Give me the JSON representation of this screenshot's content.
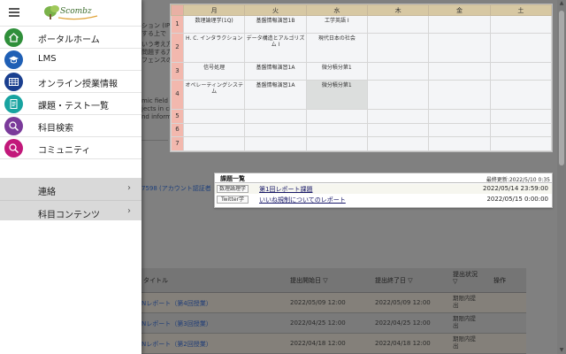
{
  "drawer": {
    "logo_text": "Scombz",
    "nav_items": [
      {
        "label": "ポータルホーム",
        "icon": "home-icon",
        "color": "#2f8f3a"
      },
      {
        "label": "LMS",
        "icon": "graduation-cap-icon",
        "color": "#1f5fb5"
      },
      {
        "label": "オンライン授業情報",
        "icon": "calendar-grid-icon",
        "color": "#1a3f8f"
      },
      {
        "label": "課題・テスト一覧",
        "icon": "clipboard-list-icon",
        "color": "#17a3a0"
      },
      {
        "label": "科目検索",
        "icon": "search-icon",
        "color": "#7a3a9a"
      },
      {
        "label": "コミュニティ",
        "icon": "search-people-icon",
        "color": "#c2187a"
      }
    ],
    "sub_items": [
      {
        "label": "連絡",
        "chevron": "›"
      },
      {
        "label": "科目コンテンツ",
        "chevron": "›"
      }
    ]
  },
  "timetable": {
    "days": [
      "月",
      "火",
      "水",
      "木",
      "金",
      "土"
    ],
    "periods": [
      "1",
      "2",
      "3",
      "4",
      "5",
      "6",
      "7"
    ],
    "cells": [
      [
        "数理論理学(1Q)",
        "基盤情報演習1B",
        "工学英語 I",
        "",
        "",
        ""
      ],
      [
        "H. C. インタラクション",
        "データ構造とアルゴリズム I",
        "現代日本の社会",
        "",
        "",
        ""
      ],
      [
        "信号処理",
        "基盤情報演習1A",
        "微分積分第1",
        "",
        "",
        ""
      ],
      [
        "オペレーティングシステム",
        "基盤情報演習1A",
        "微分積分第1",
        "",
        "",
        ""
      ],
      [
        "",
        "",
        "",
        "",
        "",
        ""
      ],
      [
        "",
        "",
        "",
        "",
        "",
        ""
      ],
      [
        "",
        "",
        "",
        "",
        "",
        ""
      ]
    ]
  },
  "tasks": {
    "title": "課題一覧",
    "updated": "最終更新:2022/5/10 0:35",
    "rows": [
      {
        "course": "数理論理学",
        "title": "第1回レポート課題",
        "due": "2022/05/14 23:59:00"
      },
      {
        "course": "Twitter学",
        "title": "いいね規制についてのレポート",
        "due": "2022/05/15 0:00:00"
      }
    ]
  },
  "background": {
    "snippets": [
      "ション (IP",
      "する上で",
      "いう考え方",
      "問題する力",
      "フェンスの",
      "mic field",
      "jects in ci",
      "nd inform"
    ],
    "account_text": "7598 (アカウント認証者",
    "assign_headers": {
      "title": "タイトル",
      "start": "提出開始日 ▽",
      "end": "提出終了日 ▽",
      "status": "提出状況 ▽",
      "action": "操作"
    },
    "assign_rows": [
      {
        "title": "Nレポート（第4回授業）",
        "start": "2022/05/09 12:00",
        "end": "2022/05/09 12:00",
        "status": "期限内提出"
      },
      {
        "title": "Nレポート（第3回授業）",
        "start": "2022/04/25 12:00",
        "end": "2022/04/25 12:00",
        "status": "期限内提出"
      },
      {
        "title": "Nレポート（第2回授業）",
        "start": "2022/04/18 12:00",
        "end": "2022/04/18 12:00",
        "status": "期限内提出"
      }
    ]
  }
}
